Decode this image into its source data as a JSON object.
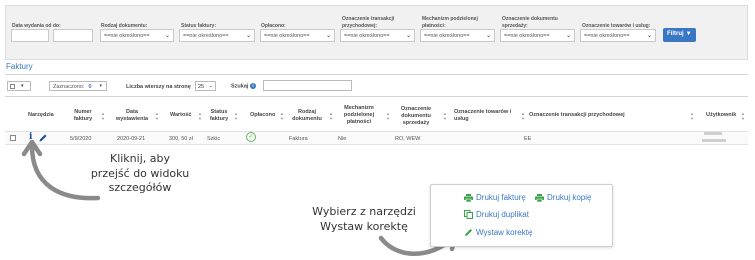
{
  "filters": {
    "issue_date_label": "Data wydania od do:",
    "doc_type_label": "Rodzaj dokumentu:",
    "status_label": "Status faktury:",
    "paid_label": "Opłacono:",
    "trans_label": "Oznaczenie transakcji przychodowej:",
    "mech_label": "Mechanizm podzielonej płatności:",
    "salesdoc_label": "Oznaczenie dokumentu sprzedaży:",
    "goods_label": "Oznaczenie towarów i usług:",
    "unspecified": "==nie określono==",
    "filter_button": "Filtruj"
  },
  "section_title": "Faktury",
  "toolbar": {
    "selected_label": "Zaznaczono:",
    "selected_count": "0",
    "per_page_label": "Liczba wierszy na stronę",
    "per_page_value": "25",
    "search_label": "Szukaj"
  },
  "columns": {
    "tools": "Narzędzia",
    "number": "Numer faktury",
    "date": "Data wystawienia",
    "value": "Wartość",
    "status": "Status faktury",
    "paid": "Opłacono",
    "doc_type": "Rodzaj dokumentu",
    "mechanism": "Mechanizm podzielonej płatności",
    "sales_doc": "Oznaczenie dokumentu sprzedaży",
    "goods": "Oznaczenie towarów i usług",
    "trans": "Oznaczenie transakcji przychodowej",
    "user": "Użytkownik"
  },
  "row": {
    "number": "5/9/2020",
    "date": "2020-09-21",
    "value": "300, 50 zł",
    "status": "Szkic",
    "doc_type": "Faktura",
    "mechanism": "Nie",
    "sales_doc": "RO, WEW",
    "trans": "EE"
  },
  "callouts": {
    "details": [
      "Kliknij, aby",
      "przejść do widoku",
      "szczegółów"
    ],
    "correction": [
      "Wybierz z narzędzi",
      "Wystaw korektę"
    ]
  },
  "menu": {
    "print_invoice": "Drukuj fakturę",
    "print_copy": "Drukuj kopię",
    "print_duplicate": "Drukuj duplikat",
    "issue_correction": "Wystaw korektę"
  },
  "colors": {
    "accent": "#3a78c3",
    "success": "#3aa34a"
  }
}
